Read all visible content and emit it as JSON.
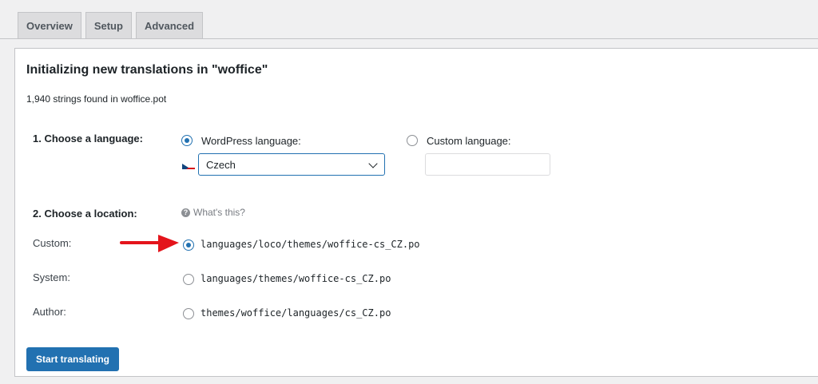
{
  "tabs": [
    {
      "label": "Overview"
    },
    {
      "label": "Setup"
    },
    {
      "label": "Advanced"
    }
  ],
  "panel": {
    "title": "Initializing new translations in \"woffice\"",
    "strings_found": "1,940 strings found in woffice.pot"
  },
  "language": {
    "label": "1. Choose a language:",
    "wordpress_label": "WordPress language:",
    "wordpress_checked": true,
    "selected": "Czech",
    "custom_label": "Custom language:",
    "custom_checked": false,
    "custom_value": ""
  },
  "location": {
    "label": "2. Choose a location:",
    "help": "What's this?",
    "options": [
      {
        "label": "Custom:",
        "path": "languages/loco/themes/woffice-cs_CZ.po",
        "checked": true
      },
      {
        "label": "System:",
        "path": "languages/themes/woffice-cs_CZ.po",
        "checked": false
      },
      {
        "label": "Author:",
        "path": "themes/woffice/languages/cs_CZ.po",
        "checked": false
      }
    ]
  },
  "submit": {
    "label": "Start translating"
  },
  "colors": {
    "accent": "#2271b1",
    "arrow": "#e4141b"
  },
  "icons": {
    "help": "question-circle-icon",
    "flag": "czech-flag-icon",
    "dropdown": "chevron-down-icon",
    "annotation": "red-arrow-icon"
  }
}
